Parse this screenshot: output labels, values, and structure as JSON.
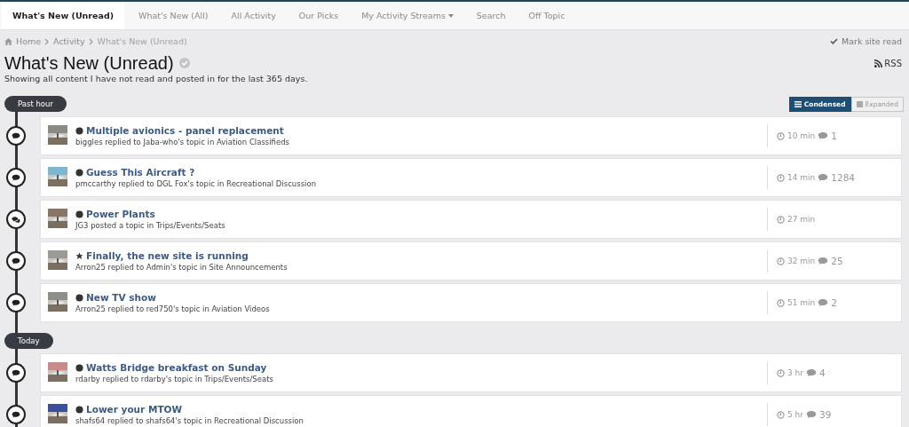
{
  "nav": [
    {
      "label": "What's New (Unread)",
      "selected": true,
      "dropdown": false
    },
    {
      "label": "What's New (All)",
      "selected": false,
      "dropdown": false
    },
    {
      "label": "All Activity",
      "selected": false,
      "dropdown": false
    },
    {
      "label": "Our Picks",
      "selected": false,
      "dropdown": false
    },
    {
      "label": "My Activity Streams",
      "selected": false,
      "dropdown": true
    },
    {
      "label": "Search",
      "selected": false,
      "dropdown": false
    },
    {
      "label": "Off Topic",
      "selected": false,
      "dropdown": false
    }
  ],
  "breadcrumb": [
    {
      "label": "Home",
      "current": false
    },
    {
      "label": "Activity",
      "current": false
    },
    {
      "label": "What's New (Unread)",
      "current": true
    }
  ],
  "mark_read": "Mark site read",
  "title": "What's New (Unread)",
  "rss": "RSS",
  "subtitle": "Showing all content I have not read and posted in for the last 365 days.",
  "view_toggle": [
    {
      "label": "Condensed",
      "selected": true
    },
    {
      "label": "Expanded",
      "selected": false
    }
  ],
  "groups": [
    {
      "label": "Past hour",
      "items": [
        {
          "title": "Multiple avionics - panel replacement",
          "featured": false,
          "kind": "reply",
          "meta": "biggles replied to Jaba-who's topic in Aviation Classifieds",
          "time": "10 min",
          "replies": "1"
        },
        {
          "title": "Guess This Aircraft ?",
          "featured": false,
          "kind": "reply",
          "meta": "pmccarthy replied to DGL Fox's topic in Recreational Discussion",
          "time": "14 min",
          "replies": "1284"
        },
        {
          "title": "Power Plants",
          "featured": false,
          "kind": "topic",
          "meta": "JG3 posted a topic in Trips/Events/Seats",
          "time": "27 min"
        },
        {
          "title": "Finally, the new site is running",
          "featured": true,
          "kind": "reply",
          "meta": "Arron25 replied to Admin's topic in Site Announcements",
          "time": "32 min",
          "replies": "25"
        },
        {
          "title": "New TV show",
          "featured": false,
          "kind": "reply",
          "meta": "Arron25 replied to red750's topic in Aviation Videos",
          "time": "51 min",
          "replies": "2"
        }
      ]
    },
    {
      "label": "Today",
      "items": [
        {
          "title": "Watts Bridge breakfast on Sunday",
          "featured": false,
          "kind": "reply",
          "meta": "rdarby replied to rdarby's topic in Trips/Events/Seats",
          "time": "3 hr",
          "replies": "4"
        },
        {
          "title": "Lower your MTOW",
          "featured": false,
          "kind": "reply",
          "meta": "shafs64 replied to shafs64's topic in Recreational Discussion",
          "time": "5 hr",
          "replies": "39"
        }
      ]
    }
  ]
}
